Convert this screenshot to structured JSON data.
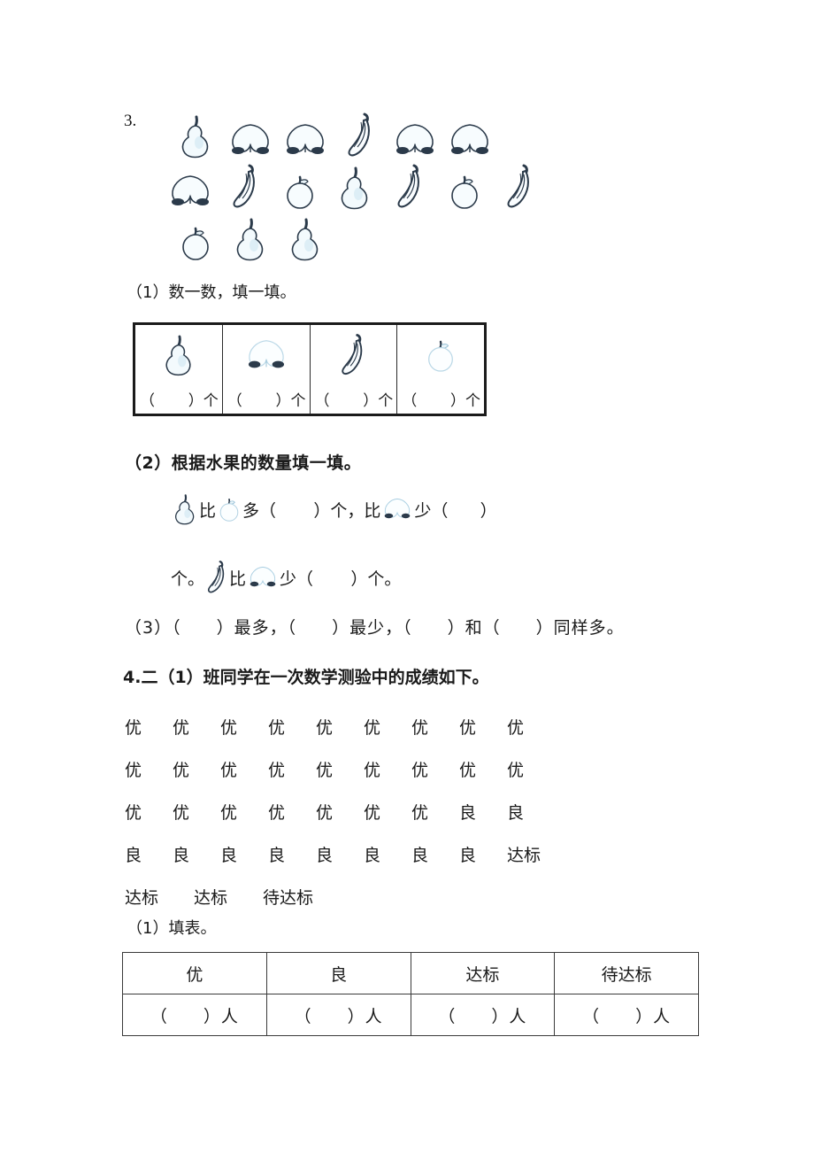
{
  "colors": {
    "ink": "#1a1a1a",
    "fruit_outline": "#2b3a4a",
    "fruit_tint": "#cfe3ef",
    "table_border": "#1b1b1b"
  },
  "section3": {
    "number": "3.",
    "fruit_rows": [
      [
        "pear",
        "peach",
        "peach",
        "banana",
        "peach",
        "peach"
      ],
      [
        "peach",
        "banana",
        "apple",
        "pear",
        "banana",
        "apple",
        "banana"
      ],
      [
        "apple",
        "pear",
        "pear"
      ]
    ],
    "q1": {
      "label": "（1）数一数，填一填。",
      "table": {
        "icons": [
          "pear",
          "peach",
          "banana",
          "apple"
        ],
        "blanks": [
          "（",
          "）个"
        ]
      }
    },
    "q2": {
      "label": "（2）根据水果的数量填一填。",
      "line1": {
        "icon_a": "pear",
        "text_bi_1": "比",
        "icon_b": "apple",
        "text_duo": "多（",
        "text_ge_comma": "）个，比",
        "icon_c": "peach",
        "text_shao": "少（",
        "text_end": "）"
      },
      "line2": {
        "text_ge": "个。",
        "icon_a": "banana",
        "text_bi": "比",
        "icon_b": "peach",
        "text_shao": "少（",
        "text_end": "）个。"
      }
    },
    "q3": {
      "text": "（3）（　　）最多，（　　）最少，（　　）和（　　）同样多。"
    }
  },
  "section4": {
    "heading": "4.二（1）班同学在一次数学测验中的成绩如下。",
    "grade_rows": [
      [
        "优",
        "优",
        "优",
        "优",
        "优",
        "优",
        "优",
        "优",
        "优"
      ],
      [
        "优",
        "优",
        "优",
        "优",
        "优",
        "优",
        "优",
        "优",
        "优"
      ],
      [
        "优",
        "优",
        "优",
        "优",
        "优",
        "优",
        "优",
        "良",
        "良"
      ],
      [
        "良",
        "良",
        "良",
        "良",
        "良",
        "良",
        "良",
        "良",
        "达标"
      ],
      [
        "达标",
        "达标",
        "待达标"
      ]
    ],
    "q1": {
      "label": "（1）填表。",
      "headers": [
        "优",
        "良",
        "达标",
        "待达标"
      ],
      "cells": [
        "（　　）人",
        "（　　）人",
        "（　　）人",
        "（　　）人"
      ]
    }
  }
}
